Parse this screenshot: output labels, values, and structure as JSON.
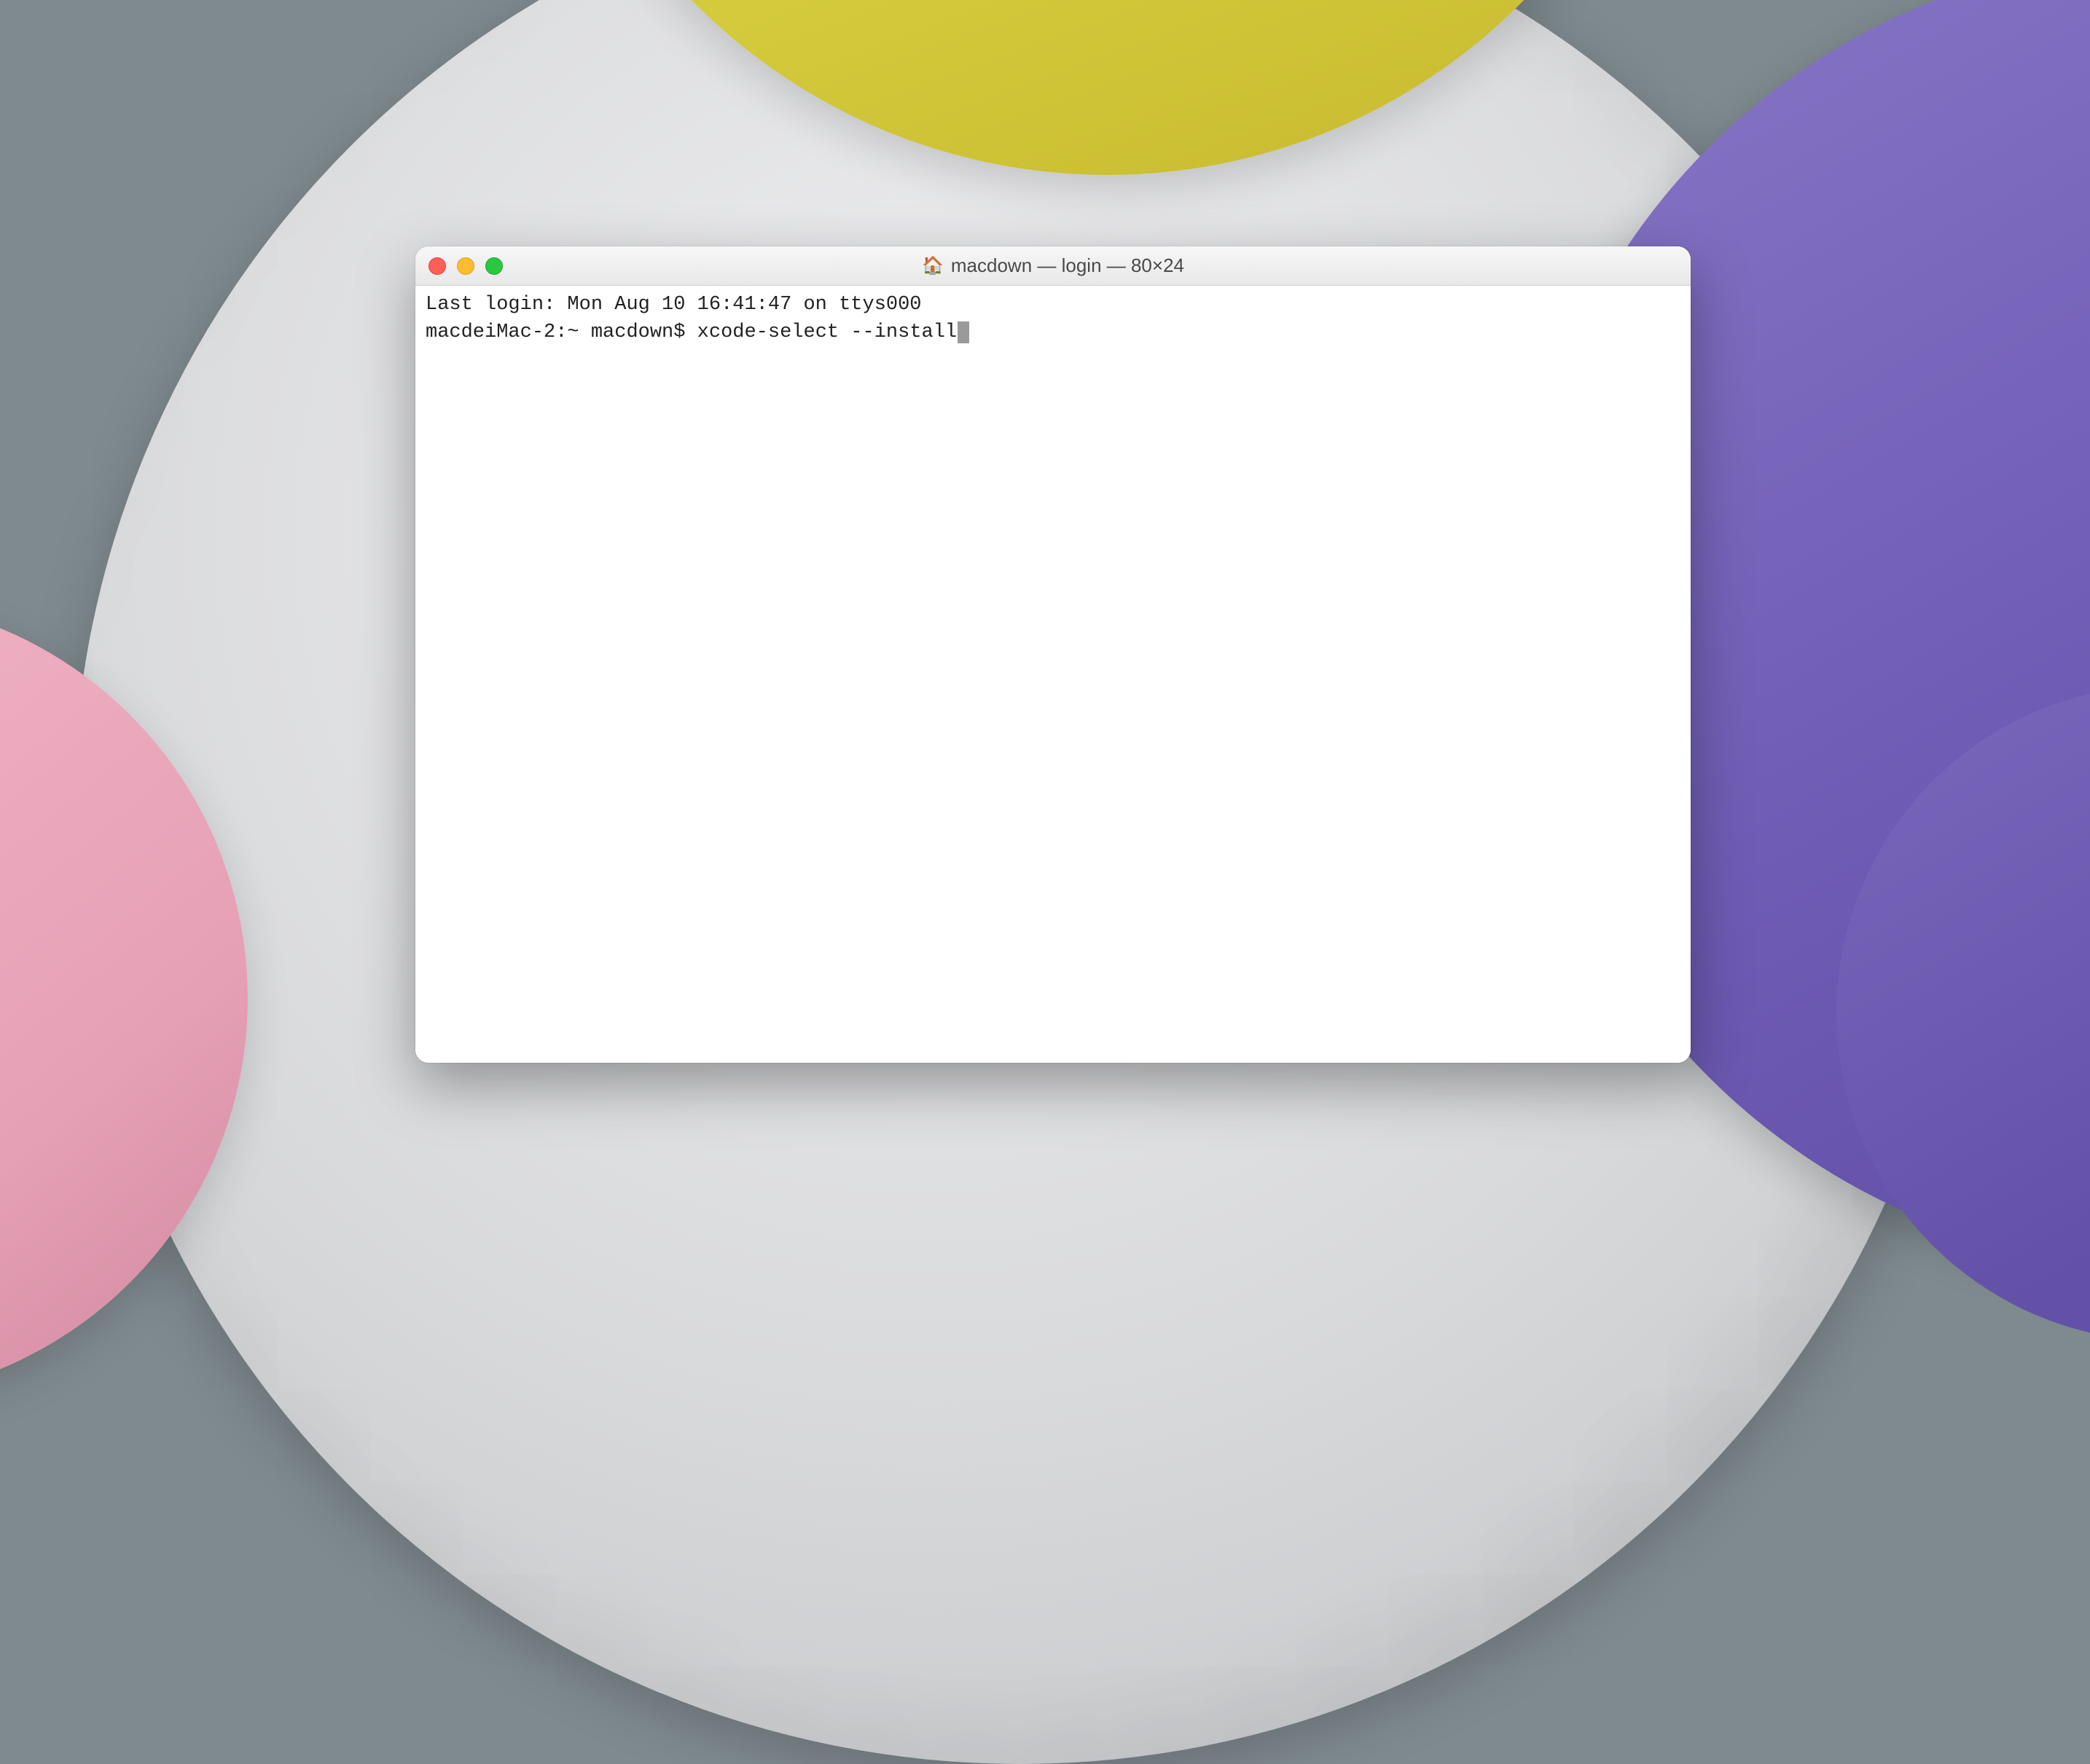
{
  "window": {
    "title": "macdown — login — 80×24",
    "folder_icon": "🏠"
  },
  "terminal": {
    "last_login_line": "Last login: Mon Aug 10 16:41:47 on ttys000",
    "prompt": "macdeiMac-2:~ macdown$ ",
    "command": "xcode-select --install"
  },
  "colors": {
    "close": "#ff5f57",
    "minimize": "#febc2e",
    "maximize": "#28c840"
  }
}
